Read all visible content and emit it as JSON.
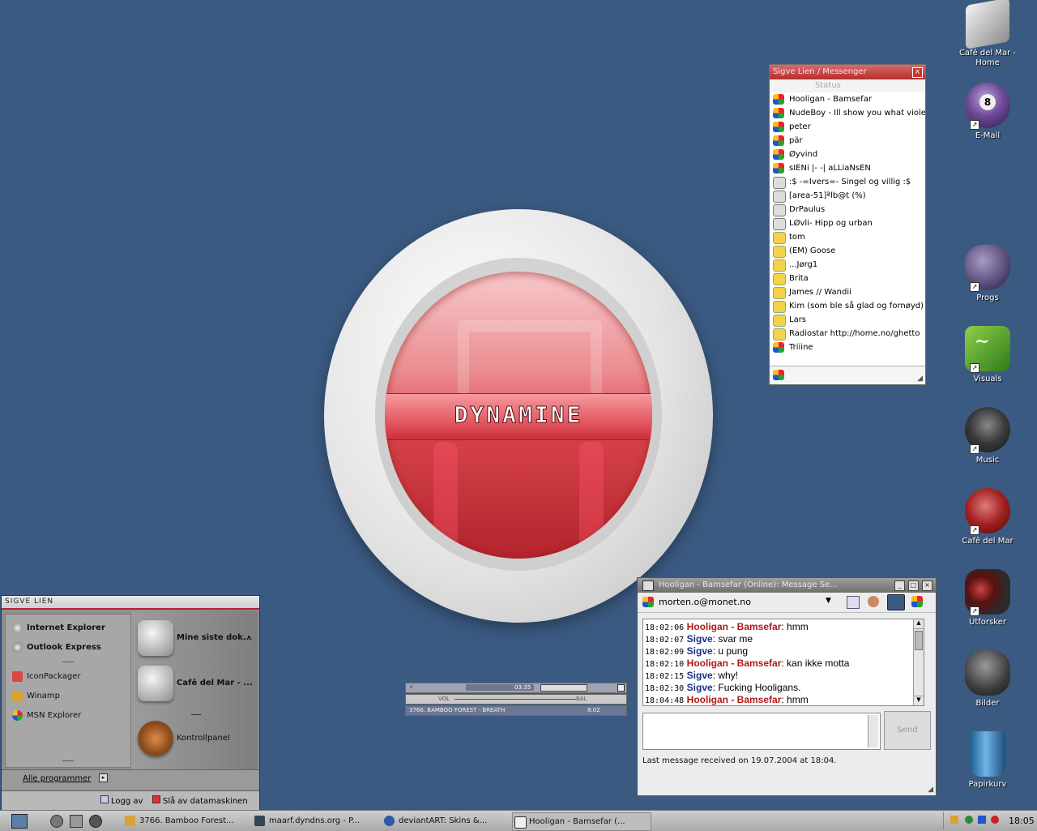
{
  "desktop": {
    "icons": [
      {
        "label": "Cafê del Mar - Home"
      },
      {
        "label": "E-Mail"
      },
      {
        "label": "Progs"
      },
      {
        "label": "Visuals"
      },
      {
        "label": "Music"
      },
      {
        "label": "Cafê del Mar"
      },
      {
        "label": "Utforsker"
      },
      {
        "label": "Bilder"
      },
      {
        "label": "Papirkurv"
      }
    ],
    "logo_text": "DYNAMINE"
  },
  "messenger": {
    "title": "Sigve Lien / Messenger",
    "status_label": "Status",
    "contacts": [
      "Hooligan - Bamsefar",
      "NudeBoy - Ill show you what viole",
      "peter",
      "pär",
      "Øyvind",
      "sIENi   |- -|    aLLiaNsEN",
      ":$ -=Ivers=- Singel og villig :$",
      "[area-51]ªlb@t (%)",
      "DrPaulus",
      "LØvli- Hipp og urban",
      "tom",
      "(EM) Goose",
      "...Jørg1",
      "Brita",
      "James // Wandii",
      "Kim (som ble så glad og fornøyd)",
      "Lars",
      "Radiostar   http://home.no/ghetto",
      "Triiine"
    ]
  },
  "start_menu": {
    "user": "SIGVE LIEN",
    "pinned": [
      "Internet Explorer",
      "Outlook Express"
    ],
    "recent": [
      "IconPackager",
      "Winamp",
      "MSN Explorer"
    ],
    "right_items": [
      "Mine siste dok...",
      "Cafê del Mar - ...",
      "Kontrollpanel"
    ],
    "all_programs": "Alle programmer",
    "logoff": "Logg av",
    "shutdown": "Slå av datamaskinen"
  },
  "winamp": {
    "time": "03:35",
    "vol_label": "VOL",
    "bal_label": "BAL",
    "track": "3766. BAMBOO FOREST - BREATH",
    "track_length": "8:02"
  },
  "chat": {
    "title": "Hooligan - Bamsefar (Online): Message Se...",
    "account": "morten.o@monet.no",
    "messages": [
      {
        "time": "18:02:06",
        "name": "Hooligan - Bamsefar",
        "text": "hmm",
        "who": "h"
      },
      {
        "time": "18:02:07",
        "name": "Sigve",
        "text": "svar me",
        "who": "s"
      },
      {
        "time": "18:02:09",
        "name": "Sigve",
        "text": "u pung",
        "who": "s"
      },
      {
        "time": "18:02:10",
        "name": "Hooligan - Bamsefar",
        "text": "kan ikke motta",
        "who": "h"
      },
      {
        "time": "18:02:15",
        "name": "Sigve",
        "text": "why!",
        "who": "s"
      },
      {
        "time": "18:02:30",
        "name": "Sigve",
        "text": "Fucking Hooligans.",
        "who": "s"
      },
      {
        "time": "18:04:48",
        "name": "Hooligan - Bamsefar",
        "text": "hmm",
        "who": "h"
      }
    ],
    "send_label": "Send",
    "status": "Last message received on 19.07.2004 at 18:04."
  },
  "taskbar": {
    "tasks": [
      "3766. Bamboo Forest...",
      "maarf.dyndns.org - P...",
      "deviantART: Skins &...",
      "Hooligan - Bamsefar (..."
    ],
    "clock": "18:05"
  }
}
